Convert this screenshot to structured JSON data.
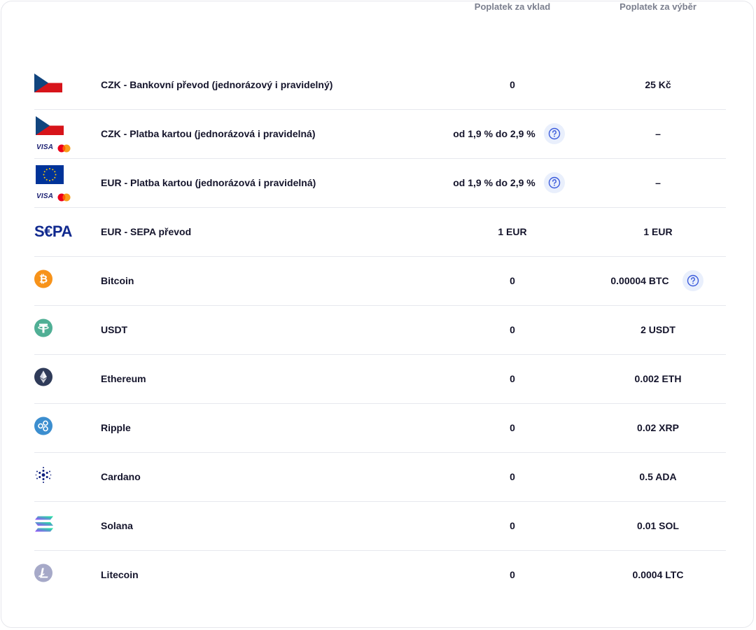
{
  "headers": {
    "deposit": "Poplatek za vklad",
    "withdrawal": "Poplatek za výběr"
  },
  "rows": [
    {
      "name": "CZK - Bankovní převod (jednorázový i pravidelný)",
      "deposit": "0",
      "withdrawal": "25 Kč",
      "icon": "czech-flag-icon"
    },
    {
      "name": "CZK - Platba kartou (jednorázová i pravidelná)",
      "deposit": "od 1,9 % do 2,9 %",
      "withdrawal": "–",
      "icon": "czech-flag-card-icon",
      "card_label": "VISA"
    },
    {
      "name": "EUR - Platba kartou (jednorázová i pravidelná)",
      "deposit": "od 1,9 % do 2,9 %",
      "withdrawal": "–",
      "icon": "eu-flag-card-icon",
      "card_label": "VISA"
    },
    {
      "name": "EUR - SEPA převod",
      "deposit": "1 EUR",
      "withdrawal": "1 EUR",
      "icon": "sepa-logo-icon",
      "logo_text": "S€PA"
    },
    {
      "name": "Bitcoin",
      "deposit": "0",
      "withdrawal": "0.00004 BTC",
      "icon": "bitcoin-icon"
    },
    {
      "name": "USDT",
      "deposit": "0",
      "withdrawal": "2 USDT",
      "icon": "tether-icon"
    },
    {
      "name": "Ethereum",
      "deposit": "0",
      "withdrawal": "0.002 ETH",
      "icon": "ethereum-icon"
    },
    {
      "name": "Ripple",
      "deposit": "0",
      "withdrawal": "0.02 XRP",
      "icon": "ripple-icon"
    },
    {
      "name": "Cardano",
      "deposit": "0",
      "withdrawal": "0.5 ADA",
      "icon": "cardano-icon"
    },
    {
      "name": "Solana",
      "deposit": "0",
      "withdrawal": "0.01 SOL",
      "icon": "solana-icon"
    },
    {
      "name": "Litecoin",
      "deposit": "0",
      "withdrawal": "0.0004 LTC",
      "icon": "litecoin-icon"
    }
  ],
  "colors": {
    "accent": "#3b5bdb",
    "info_bg": "#e9effc",
    "header_text": "#7b7f8e",
    "divider": "#e7e8ed"
  }
}
